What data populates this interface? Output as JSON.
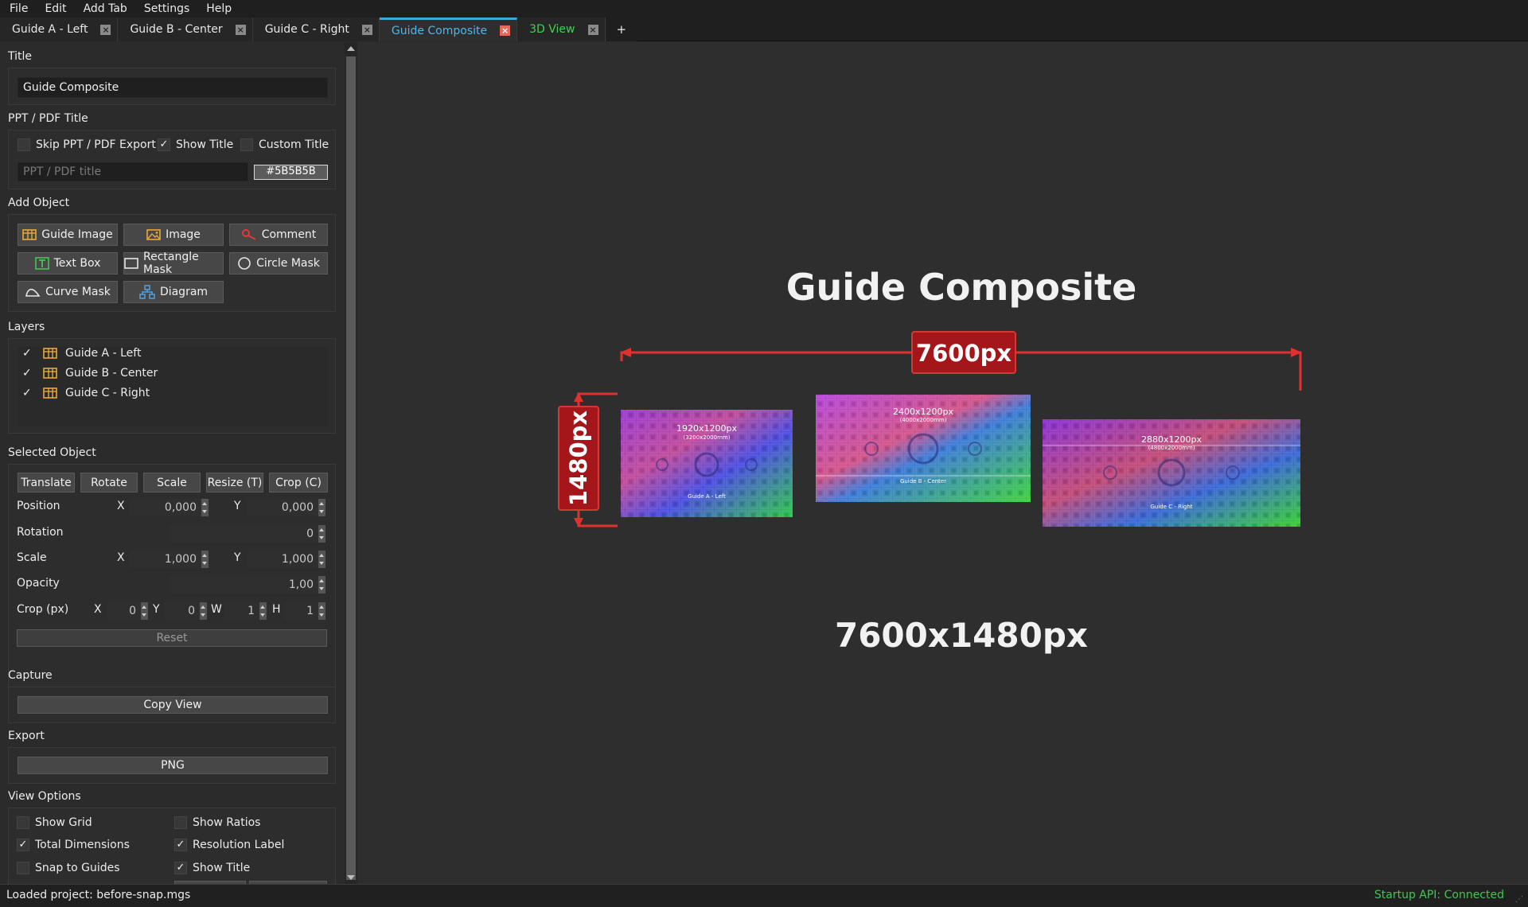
{
  "menu": [
    "File",
    "Edit",
    "Add Tab",
    "Settings",
    "Help"
  ],
  "tabs": [
    {
      "label": "Guide A - Left"
    },
    {
      "label": "Guide B - Center"
    },
    {
      "label": "Guide C - Right"
    },
    {
      "label": "Guide Composite"
    },
    {
      "label": "3D View"
    }
  ],
  "tab_add": "+",
  "tab_close": "×",
  "sections": {
    "title": "Title",
    "ppt": "PPT / PDF Title",
    "add_object": "Add Object",
    "layers": "Layers",
    "selected": "Selected Object",
    "capture": "Capture",
    "export": "Export",
    "view_options": "View Options"
  },
  "title_field": "Guide Composite",
  "ppt": {
    "skip_label": "Skip PPT / PDF Export",
    "show_title_label": "Show Title",
    "custom_title_label": "Custom Title",
    "title_placeholder": "PPT / PDF title",
    "color_hex": "#5B5B5B",
    "skip": false,
    "show_title": true,
    "custom_title": false
  },
  "add_object": {
    "guide_image": "Guide Image",
    "image": "Image",
    "comment": "Comment",
    "text_box": "Text Box",
    "rectangle_mask": "Rectangle Mask",
    "circle_mask": "Circle Mask",
    "curve_mask": "Curve Mask",
    "diagram": "Diagram"
  },
  "layers": [
    {
      "name": "Guide A - Left",
      "visible": true
    },
    {
      "name": "Guide B - Center",
      "visible": true
    },
    {
      "name": "Guide C - Right",
      "visible": true
    }
  ],
  "check_mark": "✓",
  "selected": {
    "modes": [
      "Translate",
      "Rotate",
      "Scale",
      "Resize (T)",
      "Crop (C)"
    ],
    "position_label": "Position",
    "rotation_label": "Rotation",
    "scale_label": "Scale",
    "opacity_label": "Opacity",
    "crop_label": "Crop (px)",
    "axis_x": "X",
    "axis_y": "Y",
    "axis_w": "W",
    "axis_h": "H",
    "position_x": "0,000",
    "position_y": "0,000",
    "rotation": "0",
    "scale_x": "1,000",
    "scale_y": "1,000",
    "opacity": "1,00",
    "crop_x": "0",
    "crop_y": "0",
    "crop_w": "1",
    "crop_h": "1",
    "reset": "Reset"
  },
  "capture_button": "Copy View",
  "export_button": "PNG",
  "view_options": {
    "show_grid": {
      "label": "Show Grid",
      "checked": false
    },
    "show_ratios": {
      "label": "Show Ratios",
      "checked": false
    },
    "total_dimensions": {
      "label": "Total Dimensions",
      "checked": true
    },
    "resolution_label": {
      "label": "Resolution Label",
      "checked": true
    },
    "snap_to_guides": {
      "label": "Snap to Guides",
      "checked": false
    },
    "show_title": {
      "label": "Show Title",
      "checked": true
    }
  },
  "canvas": {
    "title": "Guide Composite",
    "width_label": "7600px",
    "height_label": "1480px",
    "total_label": "7600x1480px",
    "guides": [
      {
        "res": "1920x1200px",
        "sub": "(3200x2000mm)",
        "label": "Guide A - Left"
      },
      {
        "res": "2400x1200px",
        "sub": "(4000x2000mm)",
        "label": "Guide B - Center"
      },
      {
        "res": "2880x1200px",
        "sub": "(4800x2000mm)",
        "label": "Guide C - Right"
      }
    ]
  },
  "status": {
    "left": "Loaded project: before-snap.mgs",
    "right": "Startup API: Connected"
  },
  "colors": {
    "accent_blue": "#3fa7d6",
    "dimension_red": "#e0312f",
    "dimension_box": "#a5161b",
    "status_green": "#40c84a",
    "guide_icon": "#e8a93a"
  }
}
